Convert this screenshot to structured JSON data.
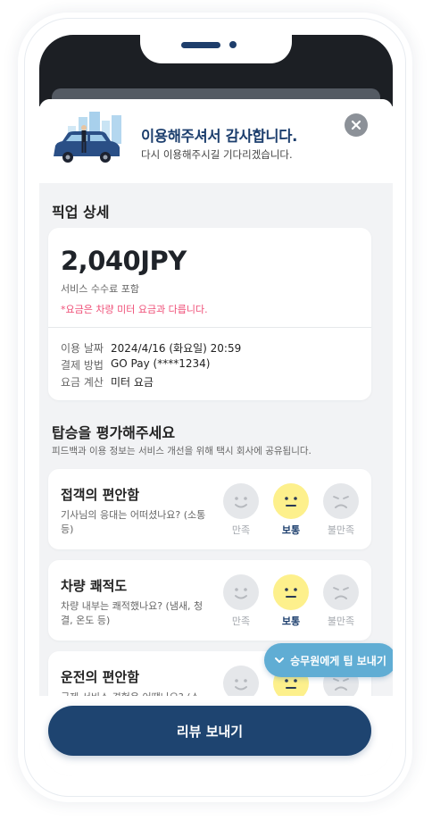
{
  "header": {
    "title": "이용해주셔서 감사합니다.",
    "subtitle": "다시 이용해주시길 기다리겠습니다."
  },
  "pickup": {
    "section_title": "픽업 상세",
    "price": "2,040JPY",
    "price_note": "서비스 수수료 포함",
    "price_warning": "*요금은 차량 미터 요금과 다릅니다.",
    "rows": [
      {
        "label": "이용 날짜",
        "value": "2024/4/16 (화요일) 20:59"
      },
      {
        "label": "결제 방법",
        "value": "GO Pay  (****1234)"
      },
      {
        "label": "요금 계산",
        "value": "미터 요금"
      }
    ]
  },
  "rating": {
    "section_title": "탑승을 평가해주세요",
    "section_sub": "피드백과 이용 정보는 서비스 개선을 위해 택시 회사에 공유됩니다.",
    "scale": [
      "만족",
      "보통",
      "불만족"
    ],
    "selected_index": 1,
    "items": [
      {
        "title": "접객의 편안함",
        "desc": "기사님의 응대는 어떠셨나요? (소통 등)"
      },
      {
        "title": "차량 쾌적도",
        "desc": "차량 내부는 쾌적했나요? (냄새, 청결, 온도 등)"
      },
      {
        "title": "운전의 편안함",
        "desc": "급제 서비스 경험은 어땠나요? (소"
      }
    ]
  },
  "tip_button": {
    "label": "승무원에게 팁 보내기",
    "icon": "chevron-down-icon"
  },
  "submit_button": {
    "label": "리뷰 보내기"
  },
  "colors": {
    "brand_navy": "#1e4470",
    "tip_blue": "#60add4",
    "selected_face": "#fdf08c",
    "warning_pink": "#ef4f77",
    "content_bg": "#f2f3f5"
  }
}
